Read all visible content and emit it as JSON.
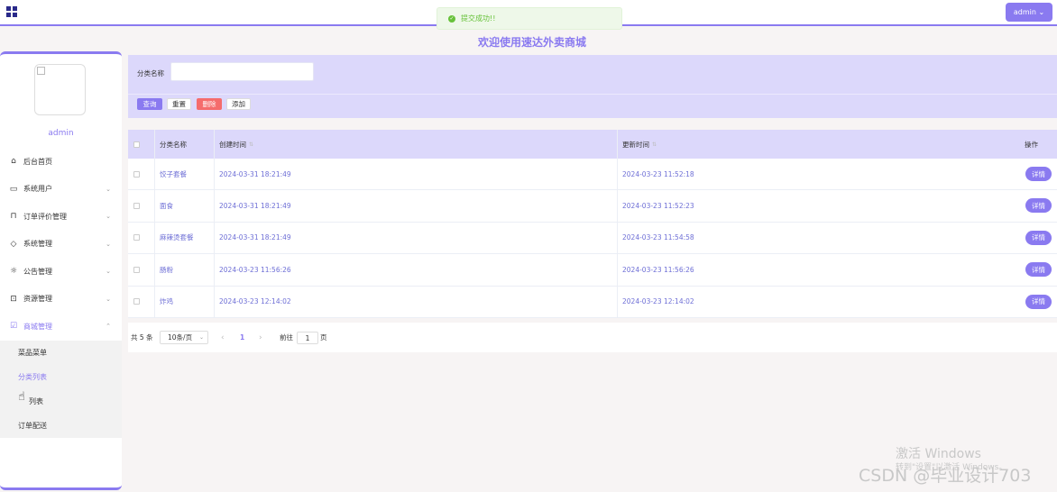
{
  "header": {
    "admin_label": "admin ⌄"
  },
  "toast": {
    "message": "提交成功!!"
  },
  "welcome": "欢迎使用速达外卖商城",
  "sidebar": {
    "username": "admin",
    "menu": [
      {
        "label": "后台首页",
        "icon": "home-icon"
      },
      {
        "label": "系统用户",
        "icon": "monitor-icon"
      },
      {
        "label": "订单评价管理",
        "icon": "bookmark-icon"
      },
      {
        "label": "系统管理",
        "icon": "tag-icon"
      },
      {
        "label": "公告管理",
        "icon": "sun-icon"
      },
      {
        "label": "资源管理",
        "icon": "inbox-icon"
      },
      {
        "label": "商城管理",
        "icon": "clipboard-icon"
      }
    ],
    "submenu": [
      {
        "label": "菜品菜单"
      },
      {
        "label": "分类列表"
      },
      {
        "label": "列表"
      },
      {
        "label": "订单配送"
      }
    ]
  },
  "search": {
    "label": "分类名称",
    "placeholder": "",
    "query_label": "查询",
    "reset_label": "重置",
    "delete_label": "删除",
    "add_label": "添加"
  },
  "table": {
    "columns": {
      "name": "分类名称",
      "created": "创建时间",
      "updated": "更新时间",
      "op": "操作"
    },
    "rows": [
      {
        "name": "饺子套餐",
        "created": "2024-03-31 18:21:49",
        "updated": "2024-03-23 11:52:18",
        "action": "详情"
      },
      {
        "name": "面食",
        "created": "2024-03-31 18:21:49",
        "updated": "2024-03-23 11:52:23",
        "action": "详情"
      },
      {
        "name": "麻辣烫套餐",
        "created": "2024-03-31 18:21:49",
        "updated": "2024-03-23 11:54:58",
        "action": "详情"
      },
      {
        "name": "肠粉",
        "created": "2024-03-23 11:56:26",
        "updated": "2024-03-23 11:56:26",
        "action": "详情"
      },
      {
        "name": "炸鸡",
        "created": "2024-03-23 12:14:02",
        "updated": "2024-03-23 12:14:02",
        "action": "详情"
      }
    ]
  },
  "pager": {
    "total": "共 5 条",
    "size": "10条/页",
    "current": "1",
    "goto": "前往",
    "input": "1",
    "page": "页"
  },
  "watermark": {
    "line1": "激活 Windows",
    "line2": "转到\"设置\"以激活 Windows。",
    "csdn": "CSDN @毕业设计703"
  }
}
